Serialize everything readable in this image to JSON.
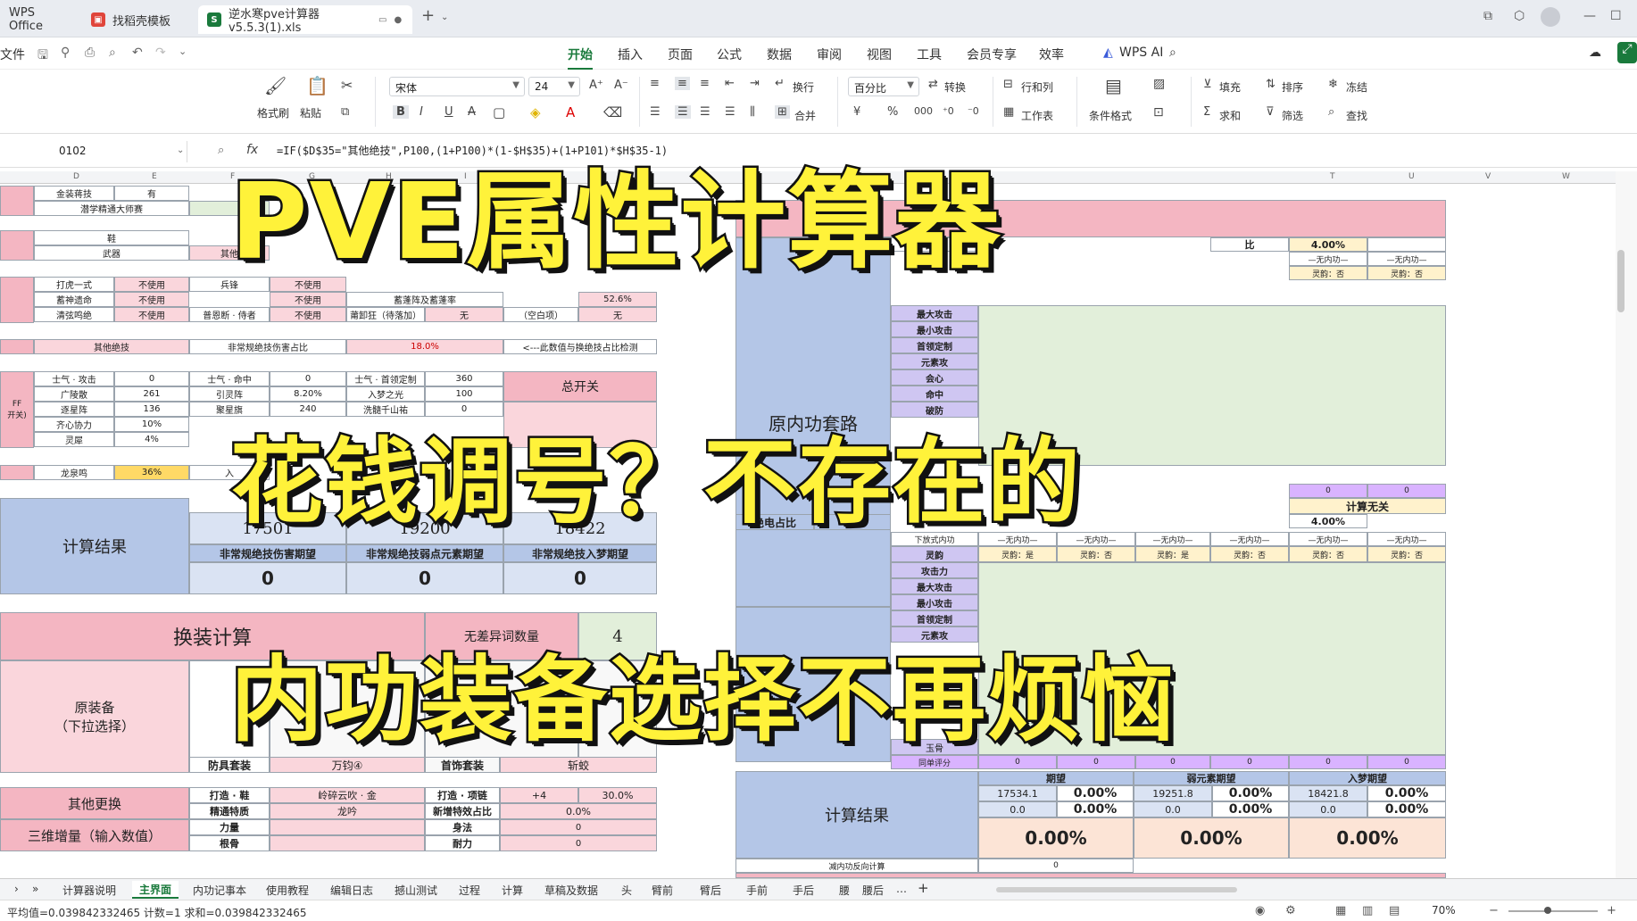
{
  "titlebar": {
    "tabs": [
      {
        "label": "WPS Office",
        "color": "#d4272b"
      },
      {
        "label": "找稻壳模板",
        "color": "#e0453b"
      },
      {
        "label": "逆水寒pve计算器v5.5.3(1).xls",
        "color": "#1a7a3c"
      }
    ],
    "new_tab": "+"
  },
  "menubar": {
    "file": "文件",
    "items": [
      "开始",
      "插入",
      "页面",
      "公式",
      "数据",
      "审阅",
      "视图",
      "工具",
      "会员专享",
      "效率"
    ],
    "active": "开始",
    "wps_ai": "WPS AI"
  },
  "ribbon": {
    "format_painter": "格式刷",
    "paste": "粘贴",
    "font_name": "宋体",
    "font_size": "24",
    "wrap": "换行",
    "merge": "合并",
    "number_format": "百分比",
    "convert": "转换",
    "row_col": "行和列",
    "worksheet": "工作表",
    "cond_format": "条件格式",
    "fill": "填充",
    "sort": "排序",
    "freeze": "冻结",
    "sum": "求和",
    "filter": "筛选",
    "find": "查找"
  },
  "formula_bar": {
    "name_box": "0102",
    "fx": "fx",
    "formula": "=IF($D$35=\"其他绝技\",P100,(1+P100)*(1-$H$35)+(1+P101)*$H$35-1)"
  },
  "columns": [
    "D",
    "E",
    "F",
    "G",
    "H",
    "I",
    "J",
    "K",
    "L",
    "M",
    "N",
    "O",
    "P",
    "Q",
    "R",
    "S",
    "T",
    "U",
    "V",
    "W"
  ],
  "sheet": {
    "r1": [
      "金装蒋技",
      "有"
    ],
    "r2": [
      "潜学精通大师赛"
    ],
    "r3": [
      "鞋"
    ],
    "r4": [
      "武器",
      "其他"
    ],
    "buff1": [
      "打虎一式",
      "不使用",
      "兵锋",
      "不使用"
    ],
    "buff2": [
      "蓄神遗命",
      "不使用",
      "不使用",
      "蓄蓬阵及蓄蓬率",
      "52.6%"
    ],
    "buff3": [
      "清弦鸣绝",
      "不使用",
      "普恩断 · 侍者",
      "不使用",
      "莆卸狂（待落加）",
      "无",
      "（空白项）",
      "无"
    ],
    "jueji": [
      "其他绝技",
      "非常规绝技伤害占比",
      "18.0%",
      "<---此数值与换绝技占比检测"
    ],
    "sq1": [
      "士气 · 攻击",
      "0",
      "士气 · 命中",
      "0",
      "士气 · 首领定制",
      "360"
    ],
    "sq2": [
      "广陵散",
      "261",
      "引灵阵",
      "8.20%",
      "入梦之光",
      "100"
    ],
    "sq3": [
      "逐星阵",
      "136",
      "聚星旗",
      "240",
      "洗髓千山祐",
      "0"
    ],
    "sq4": [
      "齐心协力",
      "10%"
    ],
    "sq5": [
      "灵犀",
      "4%"
    ],
    "master": "总开关",
    "side": [
      "FF",
      "开关)"
    ],
    "long": [
      "龙泉鸣",
      "36%",
      "入"
    ],
    "result": {
      "label": "计算结果",
      "v1": "17501",
      "v2": "19200",
      "v3": "18422",
      "h1": "非常规绝技伤害期望",
      "h2": "非常规绝技弱点元素期望",
      "h3": "非常规绝技入梦期望",
      "z1": "0",
      "z2": "0",
      "z3": "0"
    },
    "swap": {
      "label": "换装计算",
      "count_label": "无差异词数量",
      "count": "4"
    },
    "orig": {
      "label1": "原装备",
      "label2": "（下拉选择）",
      "armor": "防具套装",
      "armor_val": "万钧④",
      "jewel": "首饰套装",
      "jewel_val": "斩蛟"
    },
    "other": {
      "label": "其他更换",
      "r1a": "打造 · 鞋",
      "r1b": "岭碎云吹 · 金",
      "r1c": "打造 · 项链",
      "r1d": "+4",
      "r1e": "30.0%",
      "r2a": "精通特质",
      "r2b": "龙吟",
      "r2c": "新增特效占比",
      "r2d": "0.0%"
    },
    "stat": {
      "label": "三维增量（输入数值）",
      "a": "力量",
      "b": "身法",
      "bv": "0",
      "c": "根骨",
      "d": "耐力",
      "dv": "0"
    },
    "right": {
      "route": "原内功套路",
      "ratio_label": "占比",
      "ratio_label2": "比",
      "ratio_val": "4.00%",
      "none": "—无内功—",
      "gem": "灵韵：否",
      "gem_yes": "灵韵：是",
      "attrs": [
        "攻击力",
        "最大攻击",
        "最小攻击",
        "首领定制",
        "元素攻",
        "会心",
        "命中",
        "破防"
      ],
      "attrs2": [
        "灵韵",
        "攻击力",
        "最大攻击",
        "最小攻击",
        "首领定制",
        "元素攻"
      ],
      "lower_ratio": "绝电占比",
      "lower_ratio_val": "3.0",
      "calc_none": "计算无关",
      "lower_val": "4.00%",
      "lower_label": "下放式内功",
      "jade": "玉骨",
      "score_label": "同单评分",
      "zero": "0",
      "result": "计算结果",
      "h_exp": "期望",
      "h_weak": "弱元素期望",
      "h_dream": "入梦期望",
      "e1": "17534.1",
      "e1p": "0.00%",
      "e2": "0.0",
      "e2p": "0.00%",
      "w1": "19251.8",
      "w1p": "0.00%",
      "w2": "0.0",
      "w2p": "0.00%",
      "d1": "18421.8",
      "d1p": "0.00%",
      "d2": "0.0",
      "d2p": "0.00%",
      "tot1": "0.00%",
      "tot2": "0.00%",
      "tot3": "0.00%",
      "reduce_label": "减内功反向计算",
      "reduce_val": "0"
    }
  },
  "overlay": {
    "line1": "PVE属性计算器",
    "line2": "花钱调号？不存在的",
    "line3": "内功装备选择不再烦恼"
  },
  "sheet_tabs": [
    "计算器说明",
    "主界面",
    "内功记事本",
    "使用教程",
    "编辑日志",
    "撼山测试",
    "过程",
    "计算",
    "草稿及数据",
    "头",
    "臂前",
    "臂后",
    "手前",
    "手后",
    "腰",
    "腰后",
    "…"
  ],
  "sheet_tab_active": "主界面",
  "status": {
    "text": "平均值=0.039842332465  计数=1  求和=0.039842332465",
    "zoom": "70%"
  }
}
